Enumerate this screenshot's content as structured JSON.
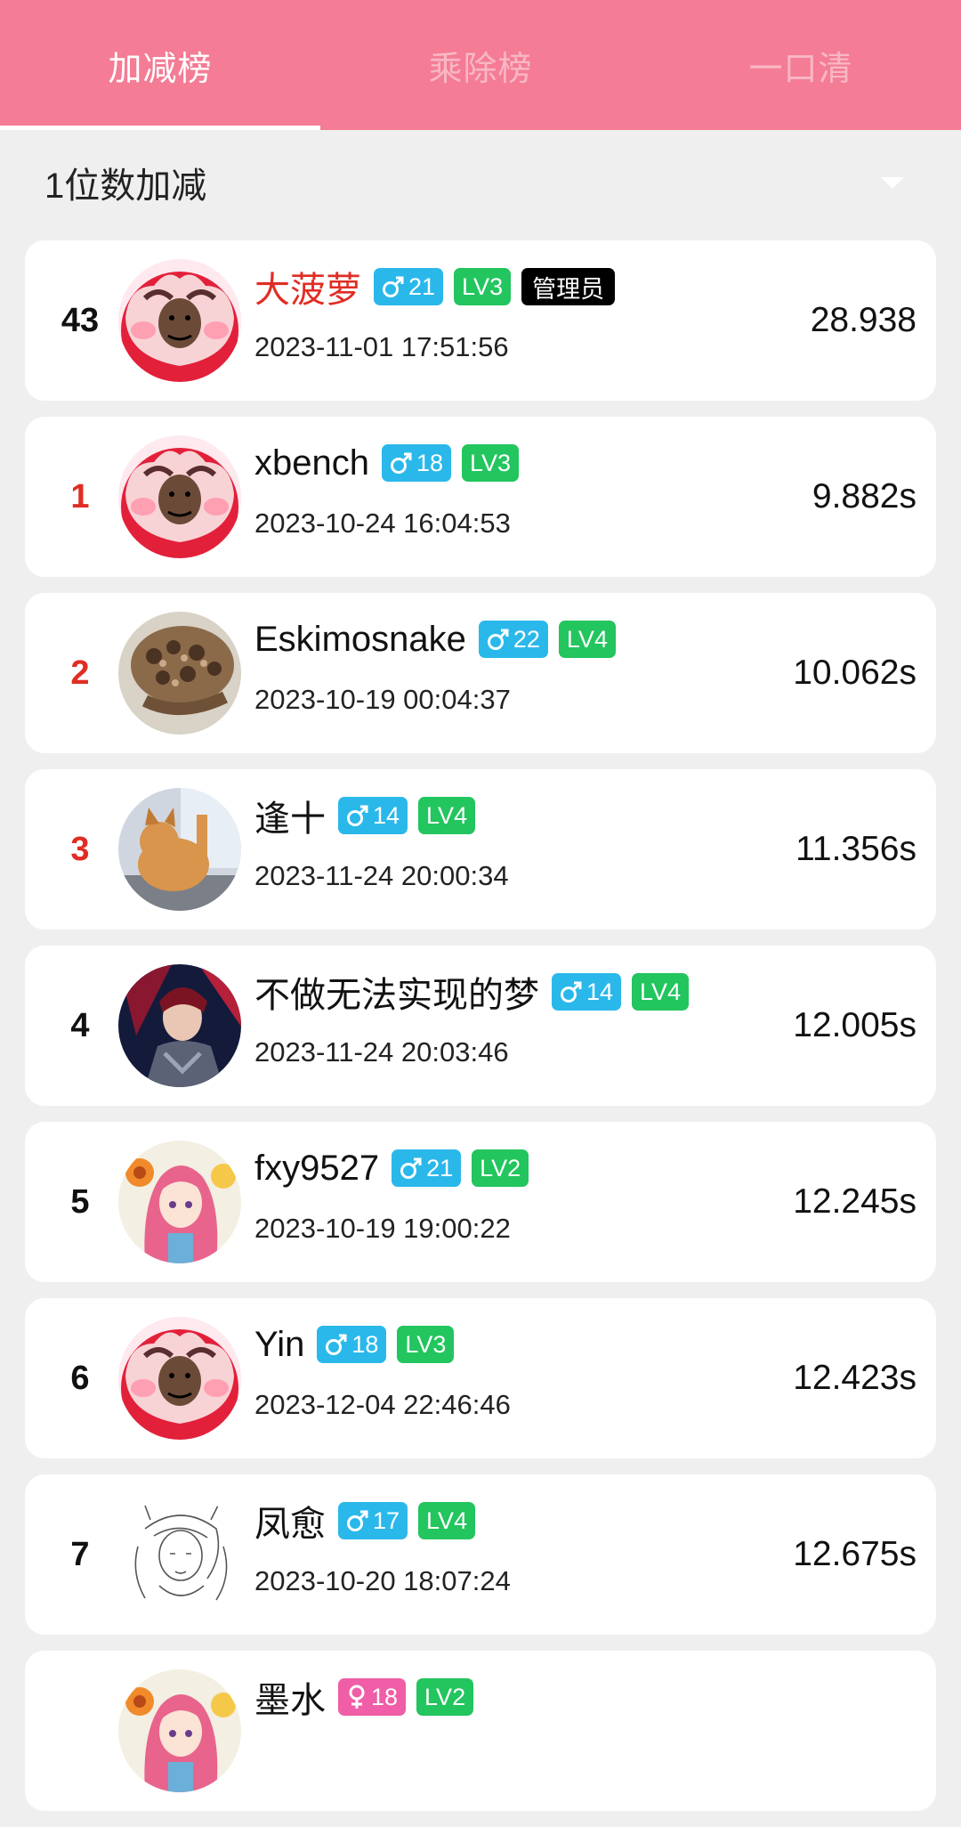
{
  "tabs": [
    {
      "label": "加减榜",
      "active": true
    },
    {
      "label": "乘除榜",
      "active": false
    },
    {
      "label": "一口清",
      "active": false
    }
  ],
  "selector": {
    "label": "1位数加减"
  },
  "my_entry": {
    "rank": "43",
    "name": "大菠萝",
    "gender": "male",
    "age": "21",
    "level": "LV3",
    "role": "管理员",
    "time": "2023-11-01 17:51:56",
    "score": "28.938",
    "avatar": "meme-avatar"
  },
  "entries": [
    {
      "rank": "1",
      "name": "xbench",
      "gender": "male",
      "age": "18",
      "level": "LV3",
      "time": "2023-10-24 16:04:53",
      "score": "9.882s",
      "avatar": "meme-avatar"
    },
    {
      "rank": "2",
      "name": "Eskimosnake",
      "gender": "male",
      "age": "22",
      "level": "LV4",
      "time": "2023-10-19 00:04:37",
      "score": "10.062s",
      "avatar": "snake-avatar"
    },
    {
      "rank": "3",
      "name": "逢十",
      "gender": "male",
      "age": "14",
      "level": "LV4",
      "time": "2023-11-24 20:00:34",
      "score": "11.356s",
      "avatar": "cat-avatar"
    },
    {
      "rank": "4",
      "name": "不做无法实现的梦",
      "gender": "male",
      "age": "14",
      "level": "LV4",
      "time": "2023-11-24 20:03:46",
      "score": "12.005s",
      "avatar": "hero-avatar"
    },
    {
      "rank": "5",
      "name": "fxy9527",
      "gender": "male",
      "age": "21",
      "level": "LV2",
      "time": "2023-10-19 19:00:22",
      "score": "12.245s",
      "avatar": "anime-girl-avatar"
    },
    {
      "rank": "6",
      "name": "Yin",
      "gender": "male",
      "age": "18",
      "level": "LV3",
      "time": "2023-12-04 22:46:46",
      "score": "12.423s",
      "avatar": "meme-avatar"
    },
    {
      "rank": "7",
      "name": "凤愈",
      "gender": "male",
      "age": "17",
      "level": "LV4",
      "time": "2023-10-20 18:07:24",
      "score": "12.675s",
      "avatar": "sketch-avatar"
    },
    {
      "rank": "",
      "name": "墨水",
      "gender": "female",
      "age": "18",
      "level": "LV2",
      "time": "",
      "score": "",
      "avatar": "anime-girl-avatar"
    }
  ],
  "colors": {
    "header": "#f47c95",
    "top_rank": "#e02d24",
    "male_badge": "#2ab8ea",
    "female_badge": "#ef5ea6",
    "level_badge": "#22c55e",
    "admin_badge": "#000000"
  }
}
